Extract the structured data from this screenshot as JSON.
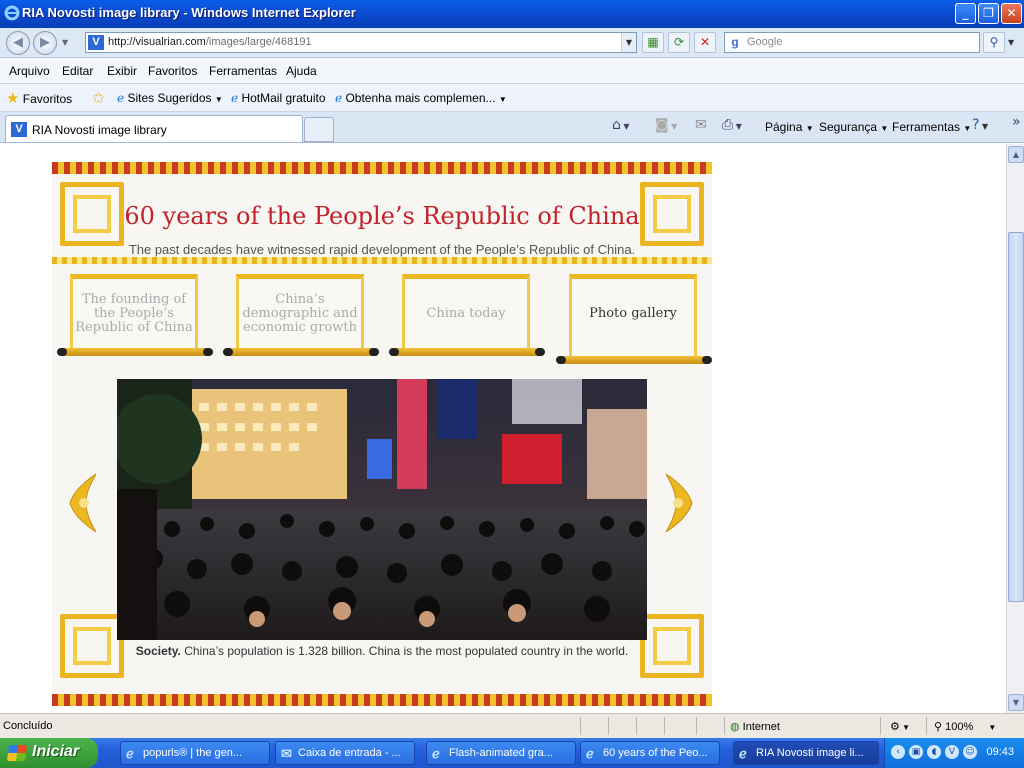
{
  "window": {
    "title": "RIA Novosti image library - Windows Internet Explorer"
  },
  "address": {
    "url_host": "http://visualrian.com",
    "url_path": "/images/large/468191",
    "search_placeholder": "Google"
  },
  "menu": [
    "Arquivo",
    "Editar",
    "Exibir",
    "Favoritos",
    "Ferramentas",
    "Ajuda"
  ],
  "favorites_bar": {
    "favorites_label": "Favoritos",
    "items": [
      "Sites Sugeridos",
      "HotMail gratuito",
      "Obtenha mais complemen..."
    ]
  },
  "tabs": {
    "active_label": "RIA Novosti image library"
  },
  "command_bar": {
    "page": "Página",
    "security": "Segurança",
    "tools": "Ferramentas"
  },
  "banner": {
    "title": "60 years of the People’s Republic of China",
    "subtitle": "The past decades have witnessed rapid development of the People’s Republic of China.",
    "scrolls": [
      "The founding of the People’s Republic of China",
      "China’s demographic and economic growth",
      "China today",
      "Photo gallery"
    ],
    "caption_bold": "Society.",
    "caption_text": " China’s population is 1.328 billion. China is the most populated country in the world."
  },
  "statusbar": {
    "status": "Concluído",
    "zone": "Internet",
    "zoom": "100%"
  },
  "taskbar": {
    "start_label": "Iniciar",
    "items": [
      "popurls® | the gen...",
      "Caixa de entrada - ...",
      "Flash-animated gra...",
      "60 years of the Peo...",
      "RIA Novosti image li..."
    ],
    "clock": "09:43"
  },
  "colors": {
    "title_red": "#c2222a",
    "gold": "#ebb822",
    "xp_blue": "#245edb"
  }
}
